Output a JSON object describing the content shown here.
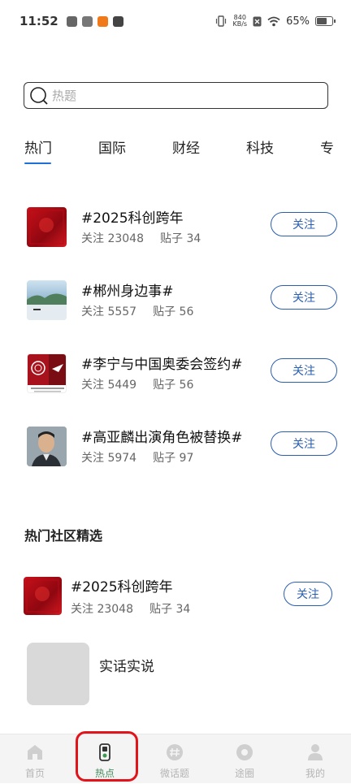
{
  "status_bar": {
    "time": "11:52",
    "net_speed_value": "840",
    "net_speed_unit": "KB/s",
    "battery_percent": "65%"
  },
  "search": {
    "placeholder": "热题"
  },
  "tabs": [
    {
      "label": "热门",
      "active": true
    },
    {
      "label": "国际",
      "active": false
    },
    {
      "label": "财经",
      "active": false
    },
    {
      "label": "科技",
      "active": false
    },
    {
      "label": "专",
      "active": false
    }
  ],
  "topics": [
    {
      "title": "#2025科创跨年",
      "follow_label": "关注",
      "followers_label": "关注 23048",
      "posts_label": "贴子 34",
      "thumb": "red-banner"
    },
    {
      "title": "#郴州身边事#",
      "follow_label": "关注",
      "followers_label": "关注 5557",
      "posts_label": "贴子 56",
      "thumb": "lake-landscape"
    },
    {
      "title": "#李宁与中国奥委会签约#",
      "follow_label": "关注",
      "followers_label": "关注 5449",
      "posts_label": "贴子 56",
      "thumb": "olympic-logo"
    },
    {
      "title": "#高亚麟出演角色被替换#",
      "follow_label": "关注",
      "followers_label": "关注 5974",
      "posts_label": "贴子 97",
      "thumb": "person-photo"
    }
  ],
  "community": {
    "section_title": "热门社区精选",
    "featured": {
      "title": "#2025科创跨年",
      "follow_label": "关注",
      "followers_label": "关注 23048",
      "posts_label": "贴子 34"
    },
    "card_label": "实话实说"
  },
  "bottom_nav": [
    {
      "label": "首页",
      "icon": "home-icon",
      "active": false
    },
    {
      "label": "热点",
      "icon": "hot-icon",
      "active": true
    },
    {
      "label": "微话题",
      "icon": "hashtag-icon",
      "active": false
    },
    {
      "label": "途圈",
      "icon": "circle-icon",
      "active": false
    },
    {
      "label": "我的",
      "icon": "profile-icon",
      "active": false
    }
  ],
  "colors": {
    "accent_blue": "#2a5fb0",
    "tab_underline": "#1f6fd6",
    "nav_active": "#4a8c5c",
    "highlight_red": "#e1141b"
  }
}
